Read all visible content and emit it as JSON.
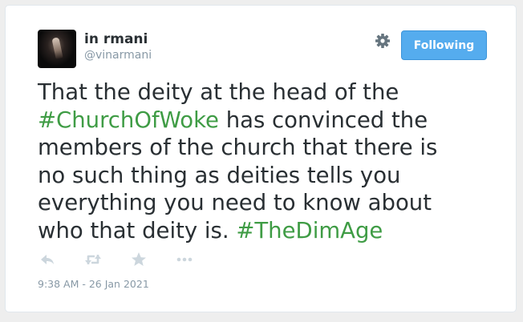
{
  "user": {
    "name": "in rmani",
    "handle": "@vinarmani"
  },
  "follow_button": {
    "label": "Following"
  },
  "tweet": {
    "lines": [
      [
        {
          "text": "That the deity at the head of the",
          "tag": false
        }
      ],
      [
        {
          "text": "#ChurchOfWoke",
          "tag": true
        },
        {
          "text": " has convinced the",
          "tag": false
        }
      ],
      [
        {
          "text": "members of the church that there is",
          "tag": false
        }
      ],
      [
        {
          "text": "no such thing as deities tells you",
          "tag": false
        }
      ],
      [
        {
          "text": "everything you need to know about",
          "tag": false
        }
      ],
      [
        {
          "text": "who that deity is. ",
          "tag": false
        },
        {
          "text": "#TheDimAge",
          "tag": true
        }
      ]
    ],
    "timestamp": "9:38 AM - 26 Jan 2021"
  },
  "icons": {
    "settings": "gear-icon",
    "reply": "reply-icon",
    "retweet": "retweet-icon",
    "favorite": "star-icon",
    "more": "more-icon"
  },
  "colors": {
    "hashtag": "#3f9c45",
    "follow_button": "#55acee",
    "text": "#292f33",
    "muted": "#8899a6",
    "icon": "#ccd6dd"
  }
}
